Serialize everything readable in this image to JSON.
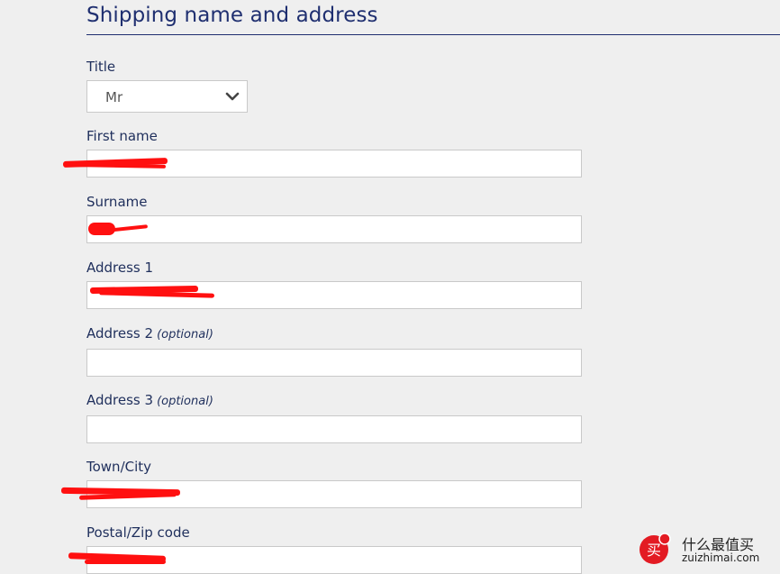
{
  "section": {
    "title": "Shipping name and address"
  },
  "fields": {
    "title": {
      "label": "Title",
      "value": "Mr"
    },
    "first_name": {
      "label": "First name"
    },
    "surname": {
      "label": "Surname"
    },
    "address1": {
      "label": "Address 1"
    },
    "address2": {
      "label": "Address 2",
      "optional": "(optional)",
      "value": ""
    },
    "address3": {
      "label": "Address 3",
      "optional": "(optional)",
      "value": ""
    },
    "town": {
      "label": "Town/City"
    },
    "postal": {
      "label": "Postal/Zip code"
    }
  },
  "watermark": {
    "cn": "什么最值买",
    "en": "zuizhimai.com",
    "logo_glyph": "买"
  },
  "colors": {
    "background": "#efefef",
    "heading": "#1f2f70",
    "redaction": "#ff1010"
  }
}
